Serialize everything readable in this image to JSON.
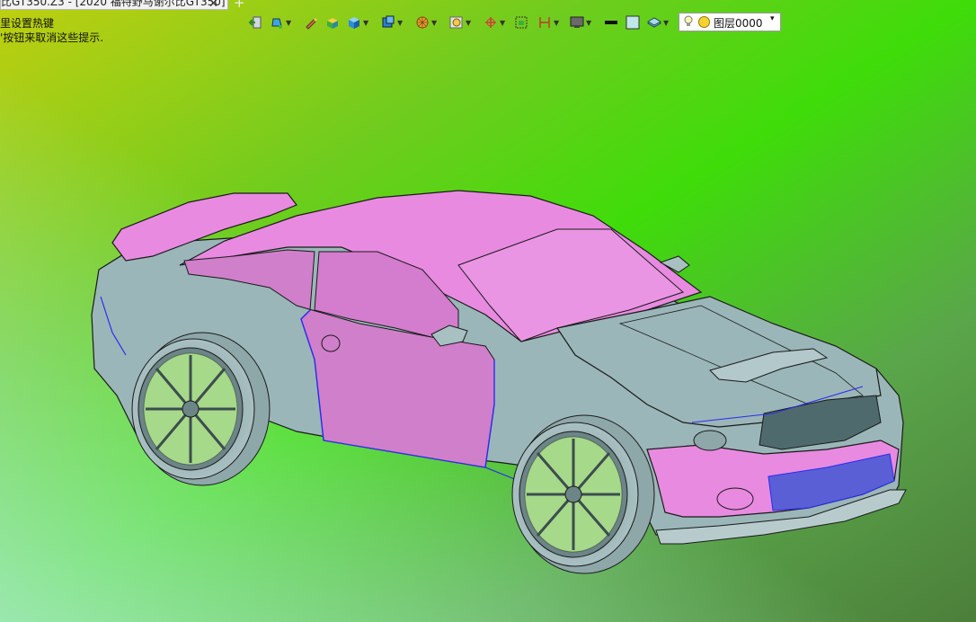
{
  "tab": {
    "title": "比GT350.Z3 - [2020 福特野马谢尔比GT350]",
    "close_glyph": "✕",
    "add_glyph": "+"
  },
  "hints": {
    "line1": "里设置热键",
    "line2": "'按钮来取消这些提示."
  },
  "toolbar": {
    "buttons": [
      {
        "name": "exit-icon",
        "dropdown": false
      },
      {
        "name": "paint-bucket-icon",
        "dropdown": true
      },
      {
        "name": "pen-icon",
        "dropdown": false
      },
      {
        "name": "shaded-box-icon",
        "dropdown": false
      },
      {
        "name": "cube-icon",
        "dropdown": true
      },
      {
        "name": "view-cube-icon",
        "dropdown": true
      },
      {
        "name": "render-sphere-icon",
        "dropdown": true
      },
      {
        "name": "zoom-fit-icon",
        "dropdown": true
      },
      {
        "name": "rotate-icon",
        "dropdown": true
      },
      {
        "name": "frame-icon",
        "dropdown": false
      },
      {
        "name": "dimension-icon",
        "dropdown": true
      },
      {
        "name": "monitor-icon",
        "dropdown": true
      },
      {
        "name": "line-style-icon",
        "dropdown": false
      },
      {
        "name": "color-square-icon",
        "dropdown": false
      },
      {
        "name": "layers-icon",
        "dropdown": true
      }
    ]
  },
  "layer": {
    "label": "图层0000",
    "dropdown_glyph": "▾"
  },
  "colors": {
    "body_pink": "#e88ae0",
    "body_gray": "#9bb6b8",
    "edge_blue": "#2a2cf0",
    "outline": "#1a1a1a"
  }
}
